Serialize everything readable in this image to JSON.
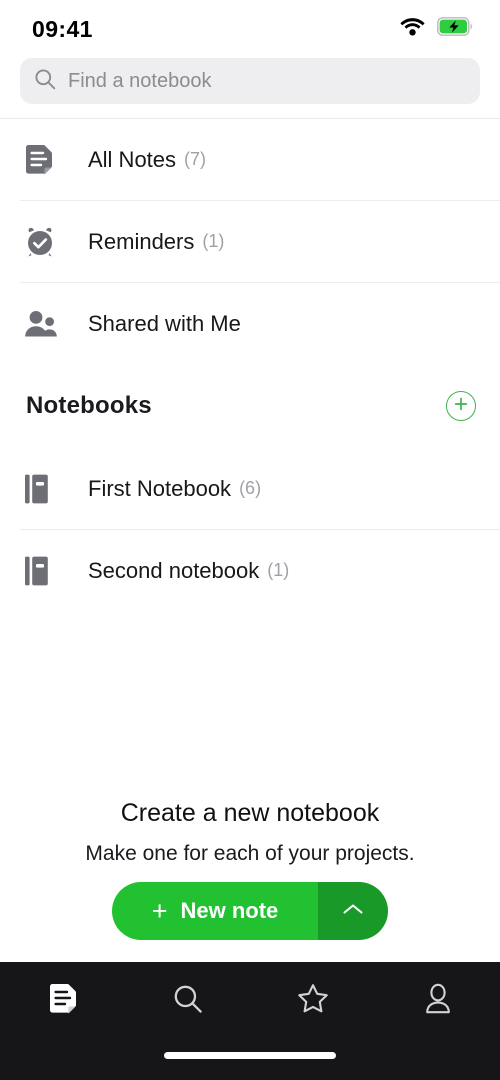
{
  "status_bar": {
    "time": "09:41",
    "wifi_icon": "wifi-icon",
    "battery_icon": "battery-charging-icon",
    "battery_color": "#2ecc40"
  },
  "search": {
    "placeholder": "Find a notebook",
    "value": "",
    "icon": "search-icon"
  },
  "nav_items": [
    {
      "label": "All Notes",
      "count": "(7)",
      "icon": "notes-document-icon"
    },
    {
      "label": "Reminders",
      "count": "(1)",
      "icon": "alarm-clock-check-icon"
    },
    {
      "label": "Shared with Me",
      "count": "",
      "icon": "people-shared-icon"
    }
  ],
  "notebooks_section": {
    "title": "Notebooks",
    "add_button_icon": "plus-circle-icon",
    "accent_color": "#3fb34f",
    "items": [
      {
        "label": "First Notebook",
        "count": "(6)",
        "icon": "notebook-icon"
      },
      {
        "label": "Second notebook",
        "count": "(1)",
        "icon": "notebook-icon"
      }
    ]
  },
  "empty_state": {
    "title": "Create a new notebook",
    "subtitle": "Make one for each of your projects."
  },
  "cta": {
    "plus": "+",
    "label": "New note",
    "caret_icon": "chevron-up-icon",
    "color": "#21c131",
    "caret_color": "#199a28"
  },
  "tab_bar": {
    "background": "#161618",
    "tabs": [
      {
        "name": "notes",
        "icon": "notes-document-icon",
        "active": true
      },
      {
        "name": "search",
        "icon": "search-icon",
        "active": false
      },
      {
        "name": "favorites",
        "icon": "star-icon",
        "active": false
      },
      {
        "name": "account",
        "icon": "person-icon",
        "active": false
      }
    ]
  }
}
